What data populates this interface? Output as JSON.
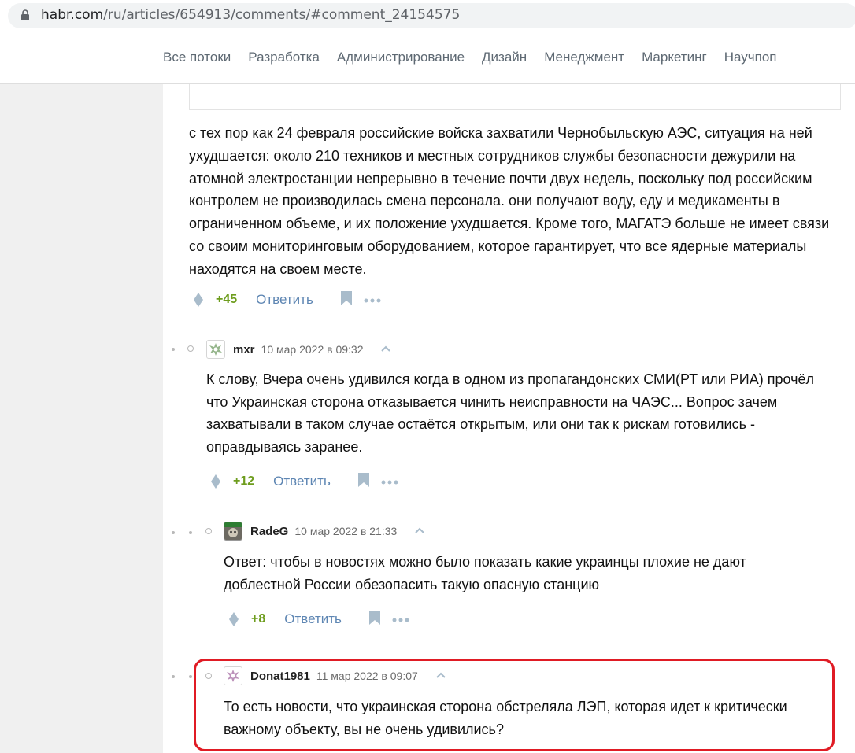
{
  "browser": {
    "url_host": "habr.com",
    "url_path": "/ru/articles/654913/comments/#comment_24154575"
  },
  "nav": {
    "items": [
      "Все потоки",
      "Разработка",
      "Администрирование",
      "Дизайн",
      "Менеджмент",
      "Маркетинг",
      "Научпоп"
    ]
  },
  "comments": [
    {
      "text": "с тех пор как 24 февраля российские войска захватили Чернобыльскую АЭС, ситуация на ней ухудшается: около 210 техников и местных сотрудников службы безопасности дежурили на атомной электростанции непрерывно в течение почти двух недель, поскольку под российским контролем не производилась смена персонала. они получают воду, еду и медикаменты в ограниченном объеме, и их положение ухудшается. Кроме того, МАГАТЭ больше не имеет связи со своим мониторинговым оборудованием, которое гарантирует, что все ядерные материалы находятся на своем месте.",
      "score": "+45",
      "reply": "Ответить"
    },
    {
      "user": "mxr",
      "date": "10 мар 2022 в 09:32",
      "text": "К слову, Вчера очень удивился когда в одном из пропагандонских СМИ(РТ или РИА) прочёл что Украинская сторона отказывается чинить неисправности на ЧАЭС... Вопрос зачем захватывали в таком случае остаётся открытым, или они так к рискам готовились - оправдываясь заранее.",
      "score": "+12",
      "reply": "Ответить"
    },
    {
      "user": "RadeG",
      "date": "10 мар 2022 в 21:33",
      "text": "Ответ: чтобы в новостях можно было показать какие украинцы плохие не дают доблестной России обезопасить такую опасную станцию",
      "score": "+8",
      "reply": "Ответить"
    },
    {
      "user": "Donat1981",
      "date": "11 мар 2022 в 09:07",
      "text": "То есть новости, что украинская сторона обстреляла ЛЭП, которая идет к критически важному объекту, вы не очень удивились?"
    }
  ],
  "colors": {
    "score": "#6e9d1e",
    "reply_link": "#5e86b3",
    "highlight": "#e01b24"
  },
  "icons": [
    "lock-icon",
    "vote-icon",
    "bookmark-icon",
    "more-icon",
    "collapse-up-icon"
  ]
}
